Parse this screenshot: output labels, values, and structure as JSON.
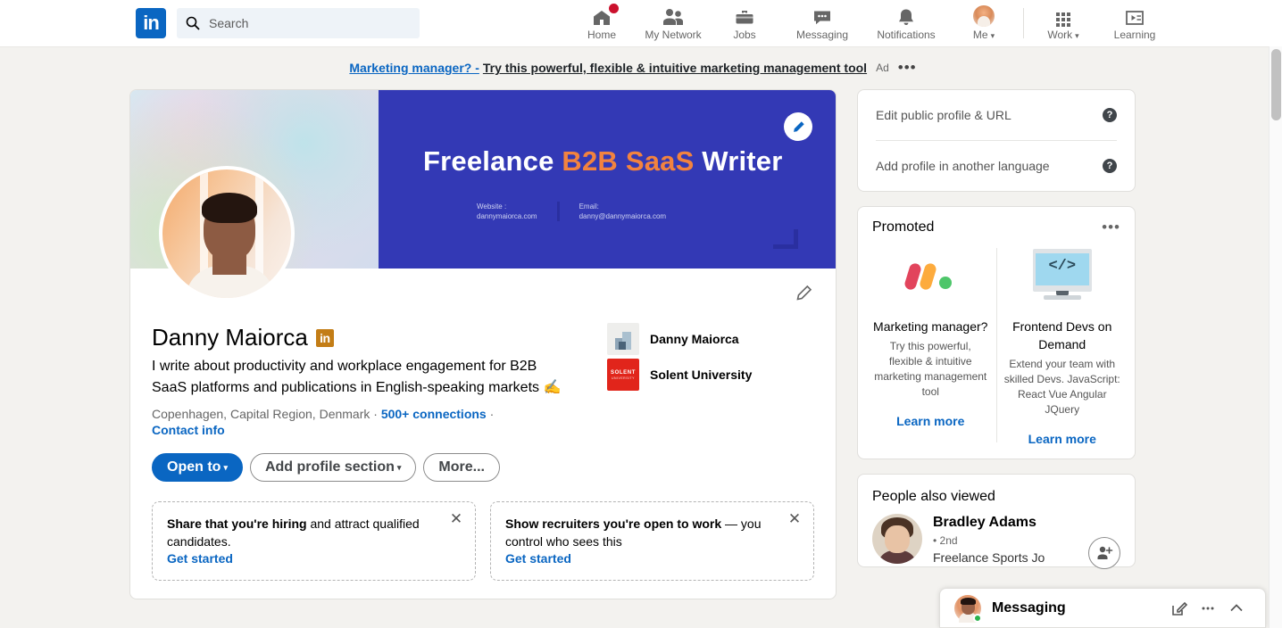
{
  "nav": {
    "logo": "in",
    "search": {
      "placeholder": "Search",
      "value": "",
      "icon": "search-icon"
    },
    "items": [
      {
        "label": "Home",
        "icon": "home-icon",
        "badge": true
      },
      {
        "label": "My Network",
        "icon": "people-icon",
        "badge": false
      },
      {
        "label": "Jobs",
        "icon": "briefcase-icon",
        "badge": false
      },
      {
        "label": "Messaging",
        "icon": "chat-bubble-icon",
        "badge": false
      },
      {
        "label": "Notifications",
        "icon": "bell-icon",
        "badge": false
      },
      {
        "label": "Me",
        "icon": "avatar-icon",
        "badge": false,
        "caret": "▾"
      }
    ],
    "right_items": [
      {
        "label": "Work",
        "icon": "grid-icon",
        "caret": "▾"
      },
      {
        "label": "Learning",
        "icon": "learning-icon"
      }
    ]
  },
  "ad_bar": {
    "link_text": "Marketing manager? -",
    "rest_text": "Try this powerful, flexible & intuitive marketing management tool",
    "tag": "Ad",
    "menu": "•••"
  },
  "banner": {
    "title_white_1": "Freelance",
    "title_orange": "B2B SaaS",
    "title_white_2": "Writer",
    "website_label": "Website :",
    "website_value": "dannymaiorca.com",
    "email_label": "Email:",
    "email_value": "danny@dannymaiorca.com",
    "edit_icon": "pencil-icon"
  },
  "profile": {
    "name": "Danny Maiorca",
    "premium_badge": "in",
    "headline": "I write about productivity and workplace engagement for B2B SaaS platforms and publications in English-speaking markets ✍",
    "location": "Copenhagen, Capital Region, Denmark",
    "separator": "·",
    "connections": "500+ connections",
    "contact_info": "Contact info",
    "edit_icon": "pencil-icon",
    "experience": [
      {
        "name": "Danny Maiorca",
        "logo": "company-logo"
      },
      {
        "name": "Solent University",
        "logo": "solent-logo",
        "logo_text_1": "SOLENT",
        "logo_text_2": "UNIVERSITY"
      }
    ],
    "buttons": [
      {
        "label": "Open to",
        "style": "primary",
        "caret": "▾"
      },
      {
        "label": "Add profile section",
        "style": "outline",
        "caret": "▾"
      },
      {
        "label": "More...",
        "style": "outline"
      }
    ],
    "prompts": [
      {
        "bold": "Share that you're hiring",
        "rest": " and attract qualified candidates.",
        "link": "Get started",
        "close": "✕"
      },
      {
        "bold": "Show recruiters you're open to work",
        "rest": " — you control who sees this",
        "link": "Get started",
        "close": "✕"
      }
    ]
  },
  "sidebar": {
    "settings_items": [
      {
        "label": "Edit public profile & URL",
        "help_icon": "question-mark-icon"
      },
      {
        "label": "Add profile in another language",
        "help_icon": "question-mark-icon"
      }
    ],
    "promoted": {
      "title": "Promoted",
      "menu": "•••",
      "ads": [
        {
          "name": "Marketing manager?",
          "desc": "Try this powerful, flexible & intuitive marketing management tool",
          "cta": "Learn more",
          "image": "monday-logo"
        },
        {
          "name": "Frontend Devs on Demand",
          "desc": "Extend your team with skilled Devs. JavaScript: React Vue Angular JQuery",
          "cta": "Learn more",
          "image": "code-monitor-icon",
          "image_glyph": "</>"
        }
      ]
    },
    "people_also_viewed": {
      "title": "People also viewed",
      "people": [
        {
          "name": "Bradley Adams",
          "degree": "• 2nd",
          "subtitle": "Freelance Sports Jo",
          "connect_icon": "person-add-icon"
        }
      ]
    }
  },
  "messaging_dock": {
    "label": "Messaging",
    "compose_icon": "compose-icon",
    "menu_icon": "more-options-icon",
    "expand_icon": "chevron-up-icon",
    "online": true
  }
}
